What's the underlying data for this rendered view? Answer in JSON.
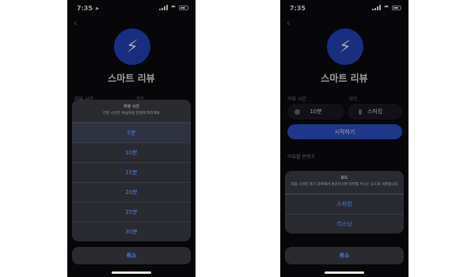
{
  "phone1": {
    "status_time": "7:35",
    "location_glyph": "➤",
    "title": "스마트 리뷰",
    "review_time_label": "리뷰 시간",
    "mode_label": "모드",
    "sheet": {
      "title": "리뷰 시간",
      "message": "리뷰 시간은 복습하실 분량에 따라해요",
      "options": [
        "5분",
        "10분",
        "15분",
        "20분",
        "25분",
        "30분"
      ],
      "selected_index": 0
    },
    "cancel": "취소"
  },
  "phone2": {
    "status_time": "7:35",
    "title": "스마트 리뷰",
    "review_time_label": "리뷰 시간",
    "mode_label": "모드",
    "time_value": "10분",
    "mode_value": "스피킹",
    "start": "시작하기",
    "section": "리뷰할 콘텐츠",
    "sheet": {
      "title": "모드",
      "message": "직접 스피킹 복기 하며해서 원문이시면 리뷰를 주시는 모드로 바뀌합니다",
      "options": [
        "스피킹",
        "리스닝"
      ]
    },
    "cancel": "취소"
  },
  "colors": {
    "accent": "#2f55d4",
    "link": "#4d7bf0",
    "background": "#0b0c10",
    "sheet": "#2a2b30"
  },
  "icons": {
    "logo": "lightning-bolt-icon",
    "back": "chevron-left-icon"
  }
}
